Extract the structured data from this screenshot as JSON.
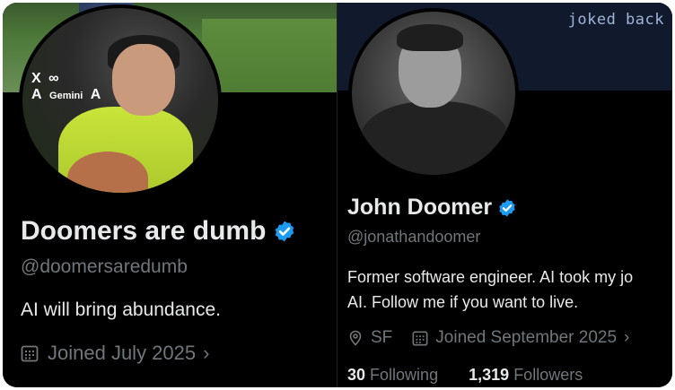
{
  "left_profile": {
    "name": "Doomers are dumb",
    "handle": "@doomersaredumb",
    "bio": "AI will bring abundance.",
    "joined": "Joined July 2025",
    "logos": [
      "X",
      "∞",
      "A",
      "Gemini",
      "A"
    ]
  },
  "right_profile": {
    "banner_text": "joked back",
    "name": "John Doomer",
    "handle": "@jonathandoomer",
    "bio_line1": "Former software engineer. AI took my jo",
    "bio_line2": "AI. Follow me if you want to live.",
    "location": "SF",
    "joined": "Joined September 2025",
    "following_count": "30",
    "following_label": "Following",
    "followers_count": "1,319",
    "followers_label": "Followers"
  },
  "colors": {
    "background": "#000000",
    "primary_text": "#e7e9ea",
    "secondary_text": "#71767b",
    "verified_blue": "#1d9bf0"
  }
}
